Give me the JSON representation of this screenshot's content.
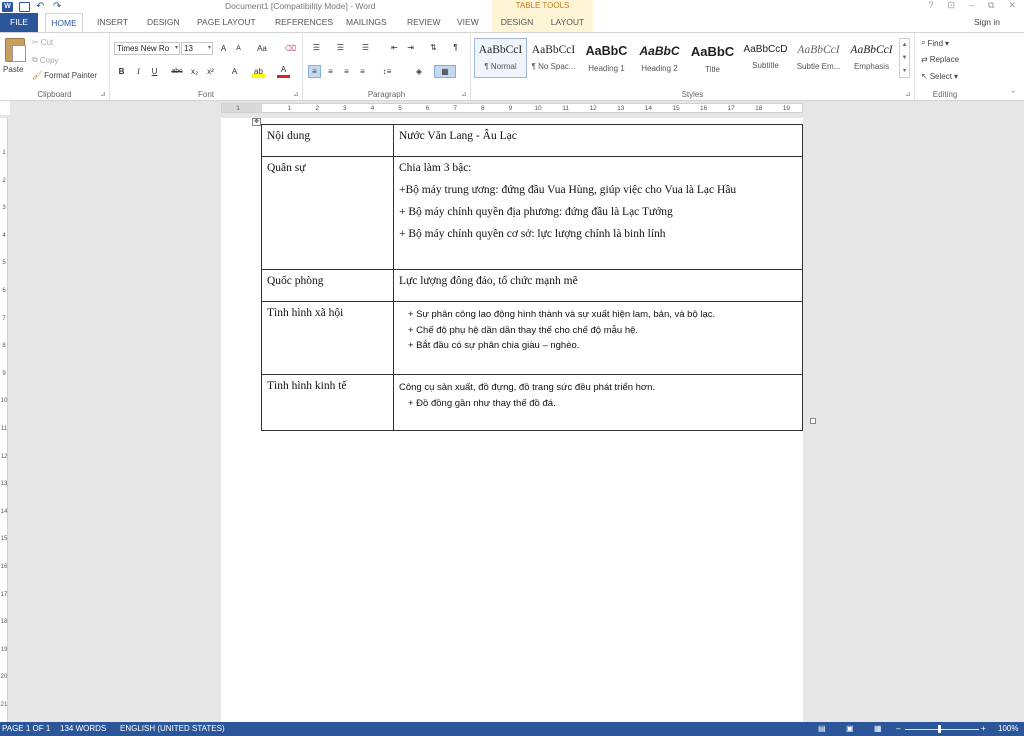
{
  "titlebar": {
    "title": "Document1 [Compatibility Mode] - Word",
    "context_tab_group": "TABLE TOOLS",
    "window_buttons": [
      "?",
      "⊡",
      "–",
      "⧉",
      "✕"
    ]
  },
  "tabs": {
    "file": "FILE",
    "home": "HOME",
    "insert": "INSERT",
    "design": "DESIGN",
    "page_layout": "PAGE LAYOUT",
    "references": "REFERENCES",
    "mailings": "MAILINGS",
    "review": "REVIEW",
    "view": "VIEW",
    "table_design": "DESIGN",
    "table_layout": "LAYOUT",
    "sign_in": "Sign in"
  },
  "clipboard": {
    "paste": "Paste",
    "cut": "Cut",
    "copy": "Copy",
    "format_painter": "Format Painter",
    "label": "Clipboard"
  },
  "font": {
    "family": "Times New Ro",
    "size": "13",
    "label": "Font",
    "grow": "A",
    "shrink": "A",
    "case": "Aa",
    "bold": "B",
    "italic": "I",
    "underline": "U",
    "strike": "abc",
    "subscript": "x₂",
    "superscript": "x²",
    "color_letter": "A"
  },
  "paragraph": {
    "label": "Paragraph",
    "pilcrow": "¶"
  },
  "styles": {
    "label": "Styles",
    "items": [
      {
        "sample": "AaBbCcI",
        "name": "¶ Normal"
      },
      {
        "sample": "AaBbCcI",
        "name": "¶ No Spac..."
      },
      {
        "sample": "AaBbC",
        "name": "Heading 1"
      },
      {
        "sample": "AaBbC",
        "name": "Heading 2"
      },
      {
        "sample": "AaBbC",
        "name": "Title"
      },
      {
        "sample": "AaBbCcD",
        "name": "Subtitle"
      },
      {
        "sample": "AaBbCcI",
        "name": "Subtle Em..."
      },
      {
        "sample": "AaBbCcI",
        "name": "Emphasis"
      }
    ]
  },
  "editing": {
    "find": "Find",
    "replace": "Replace",
    "select": "Select",
    "label": "Editing"
  },
  "ruler": {
    "ticks": [
      "1",
      "1",
      "2",
      "3",
      "4",
      "5",
      "6",
      "7",
      "8",
      "9",
      "10",
      "11",
      "12",
      "13",
      "14",
      "15",
      "16",
      "17",
      "18",
      "19"
    ]
  },
  "vruler": {
    "ticks": [
      "1",
      "2",
      "3",
      "4",
      "5",
      "6",
      "7",
      "8",
      "9",
      "10",
      "11",
      "12",
      "13",
      "14",
      "15",
      "16",
      "17",
      "18",
      "19",
      "20",
      "21"
    ]
  },
  "table": {
    "rows": [
      {
        "label": "Nội dung",
        "lines": [
          "Nước Văn Lang -  Âu Lạc"
        ]
      },
      {
        "label": "Quân sự",
        "lines": [
          "Chia làm 3 bậc:",
          "+Bộ máy trung ương: đứng đầu Vua Hùng, giúp việc cho Vua là Lạc Hầu",
          "+ Bộ máy chính quyền địa phương: đứng đầu là Lạc Tướng",
          "+ Bộ máy chính quyền cơ sở: lực lượng chính là binh lính"
        ]
      },
      {
        "label": "Quốc phòng",
        "lines": [
          "Lực lượng đông đảo, tổ chức mạnh mẽ"
        ]
      },
      {
        "label": "Tình hình xã hội",
        "lines": [
          "+ Sự phân công lao động hình thành và sự xuất hiện lam, bản, và bộ lạc.",
          "+ Chế độ phụ hệ dần dần thay thế cho chế độ mẫu hệ.",
          "+ Bắt đầu có sự phân chia giàu – nghèo."
        ]
      },
      {
        "label": "Tình hình kinh tế",
        "lines": [
          "Công cụ sản xuất, đồ đựng, đồ trang sức đều phát triển hơn.",
          "+ Đồ đồng gần như thay thế đồ đá."
        ]
      }
    ]
  },
  "status": {
    "page": "PAGE 1 OF 1",
    "words": "134 WORDS",
    "language": "ENGLISH (UNITED STATES)",
    "zoom": "100%",
    "zoom_minus": "–",
    "zoom_plus": "+"
  },
  "colors": {
    "accent": "#2b579a",
    "context_tab_bg": "#fdf5d6",
    "context_tab_text": "#c27d1a"
  }
}
